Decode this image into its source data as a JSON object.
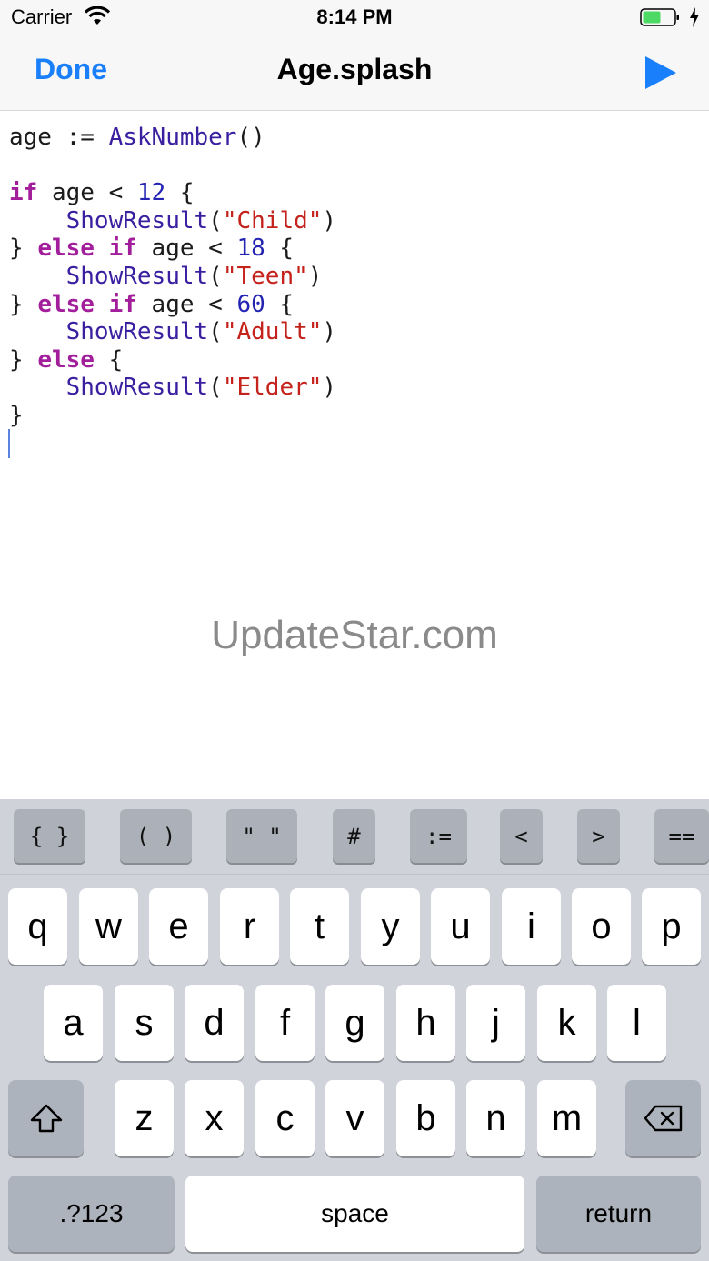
{
  "status_bar": {
    "carrier": "Carrier",
    "time": "8:14 PM"
  },
  "nav": {
    "done_label": "Done",
    "title": "Age.splash",
    "run_icon": "play-icon"
  },
  "editor": {
    "lines": [
      [
        [
          "",
          "age := "
        ],
        [
          "fn",
          "AskNumber"
        ],
        [
          "",
          "()"
        ]
      ],
      [],
      [
        [
          "kw",
          "if"
        ],
        [
          "",
          " age < "
        ],
        [
          "num",
          "12"
        ],
        [
          "",
          " {"
        ]
      ],
      [
        [
          "",
          "    "
        ],
        [
          "fn",
          "ShowResult"
        ],
        [
          "",
          "("
        ],
        [
          "str",
          "\"Child\""
        ],
        [
          "",
          ")"
        ]
      ],
      [
        [
          "",
          "} "
        ],
        [
          "kw",
          "else if"
        ],
        [
          "",
          " age < "
        ],
        [
          "num",
          "18"
        ],
        [
          "",
          " {"
        ]
      ],
      [
        [
          "",
          "    "
        ],
        [
          "fn",
          "ShowResult"
        ],
        [
          "",
          "("
        ],
        [
          "str",
          "\"Teen\""
        ],
        [
          "",
          ")"
        ]
      ],
      [
        [
          "",
          "} "
        ],
        [
          "kw",
          "else if"
        ],
        [
          "",
          " age < "
        ],
        [
          "num",
          "60"
        ],
        [
          "",
          " {"
        ]
      ],
      [
        [
          "",
          "    "
        ],
        [
          "fn",
          "ShowResult"
        ],
        [
          "",
          "("
        ],
        [
          "str",
          "\"Adult\""
        ],
        [
          "",
          ")"
        ]
      ],
      [
        [
          "",
          "} "
        ],
        [
          "kw",
          "else"
        ],
        [
          "",
          " {"
        ]
      ],
      [
        [
          "",
          "    "
        ],
        [
          "fn",
          "ShowResult"
        ],
        [
          "",
          "("
        ],
        [
          "str",
          "\"Elder\""
        ],
        [
          "",
          ")"
        ]
      ],
      [
        [
          "",
          "}"
        ]
      ]
    ]
  },
  "watermark": "UpdateStar.com",
  "accessory_keys": [
    "{ }",
    "( )",
    "\" \"",
    "#",
    ":=",
    "<",
    ">",
    "=="
  ],
  "keyboard": {
    "row1": [
      "q",
      "w",
      "e",
      "r",
      "t",
      "y",
      "u",
      "i",
      "o",
      "p"
    ],
    "row2": [
      "a",
      "s",
      "d",
      "f",
      "g",
      "h",
      "j",
      "k",
      "l"
    ],
    "row3": [
      "z",
      "x",
      "c",
      "v",
      "b",
      "n",
      "m"
    ],
    "shift_icon": "shift-icon",
    "delete_icon": "delete-icon",
    "numbers_label": ".?123",
    "space_label": "space",
    "return_label": "return"
  },
  "colors": {
    "accent": "#1a7ffb",
    "keyword": "#a21e9b",
    "function": "#3a1fa0",
    "number": "#2424b3",
    "string": "#c4221b",
    "battery": "#4cd964"
  }
}
